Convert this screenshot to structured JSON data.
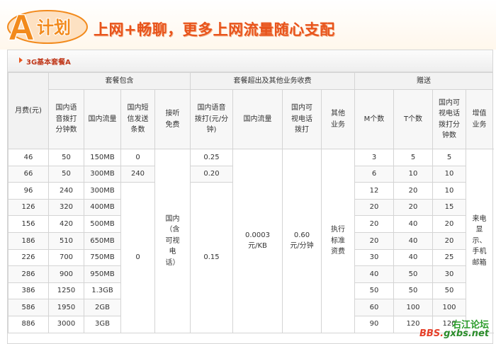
{
  "banner": {
    "logo_letter": "A",
    "logo_text": "计划",
    "headline": "上网+畅聊，更多上网流量随心支配"
  },
  "package": {
    "title": "3G基本套餐A"
  },
  "table": {
    "group_headers": {
      "fee": "月费(元)",
      "included": "套餐包含",
      "overage": "套餐超出及其他业务收费",
      "bonus": "赠送"
    },
    "col_headers": {
      "voice": "国内语音拨打分钟数",
      "data": "国内流量",
      "sms": "国内短信发送条数",
      "answer": "接听免费",
      "voice_over": "国内语音拨打(元/分钟)",
      "data_over": "国内流量",
      "video_over": "国内可视电话拨打",
      "other": "其他业务",
      "m": "M个数",
      "t": "T个数",
      "video_min": "国内可视电话拨打分钟数",
      "vas": "增值业务"
    },
    "rows": [
      {
        "fee": "46",
        "voice": "50",
        "data": "150MB",
        "m": "3",
        "t": "5",
        "video": "5"
      },
      {
        "fee": "66",
        "voice": "50",
        "data": "300MB",
        "m": "6",
        "t": "10",
        "video": "10"
      },
      {
        "fee": "96",
        "voice": "240",
        "data": "300MB",
        "m": "12",
        "t": "20",
        "video": "10"
      },
      {
        "fee": "126",
        "voice": "320",
        "data": "400MB",
        "m": "20",
        "t": "20",
        "video": "15"
      },
      {
        "fee": "156",
        "voice": "420",
        "data": "500MB",
        "m": "20",
        "t": "40",
        "video": "20"
      },
      {
        "fee": "186",
        "voice": "510",
        "data": "650MB",
        "m": "20",
        "t": "40",
        "video": "20"
      },
      {
        "fee": "226",
        "voice": "700",
        "data": "750MB",
        "m": "30",
        "t": "40",
        "video": "25"
      },
      {
        "fee": "286",
        "voice": "900",
        "data": "950MB",
        "m": "40",
        "t": "50",
        "video": "30"
      },
      {
        "fee": "386",
        "voice": "1250",
        "data": "1.3GB",
        "m": "50",
        "t": "50",
        "video": "50"
      },
      {
        "fee": "586",
        "voice": "1950",
        "data": "2GB",
        "m": "60",
        "t": "100",
        "video": "100"
      },
      {
        "fee": "886",
        "voice": "3000",
        "data": "3GB",
        "m": "90",
        "t": "120",
        "video": "120"
      }
    ],
    "sms": [
      "0",
      "240",
      "0"
    ],
    "answer_free": "国内（含可视电话）",
    "voice_over": [
      "0.25",
      "0.20",
      "0.15"
    ],
    "data_over": "0.0003元/KB",
    "video_over": "0.60元/分钟",
    "other": "执行标准资费",
    "vas": "来电显示、手机邮箱"
  },
  "watermark": {
    "top": "右江论坛",
    "bottom_prefix": "BBS.",
    "bottom_domain": "gxbs.net"
  },
  "colors": {
    "headline": "#e8541c",
    "logo_fill": "#f28a1c",
    "package_title": "#c0391c",
    "watermark_green": "#2a9c2a",
    "watermark_red": "#e6402a"
  }
}
